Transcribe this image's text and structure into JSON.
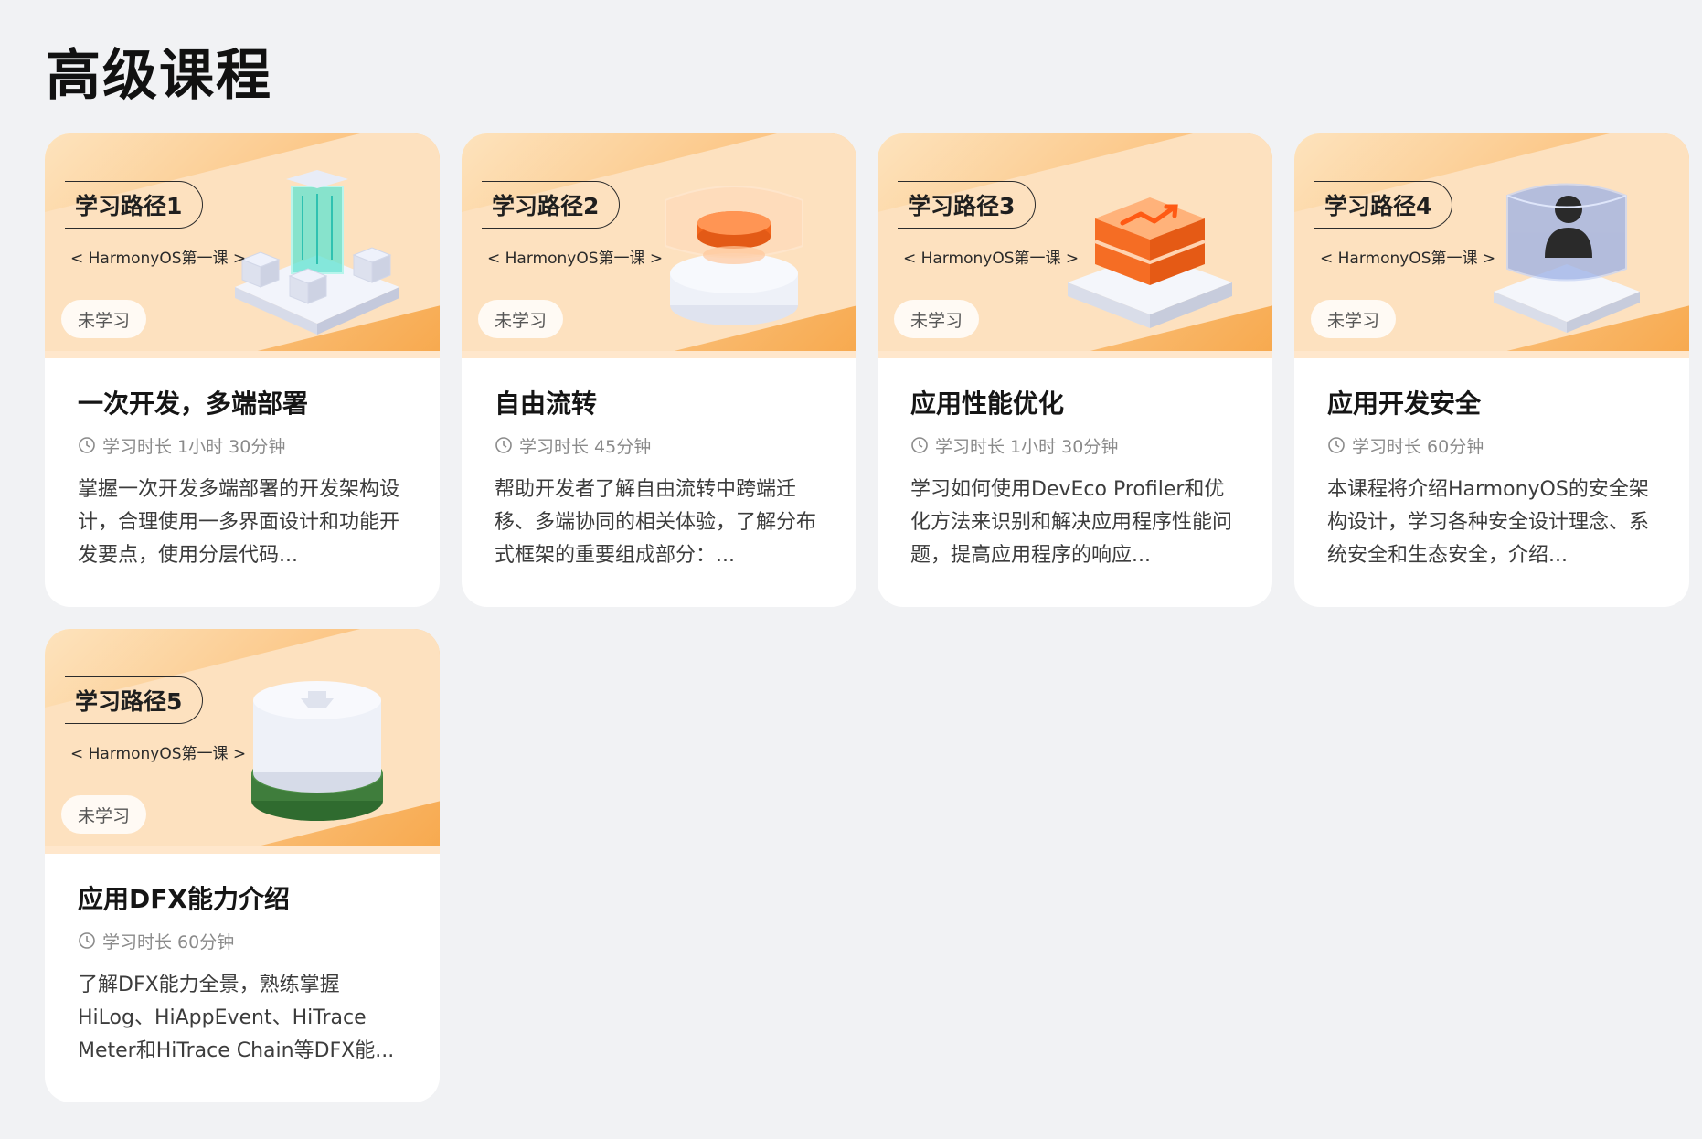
{
  "page": {
    "title": "高级课程"
  },
  "colors": {
    "background": "#f1f2f4",
    "banner_gradient_light": "#fde3bd",
    "banner_gradient_dark": "#f7a94e",
    "card": "#ffffff"
  },
  "cards": [
    {
      "path_label": "学习路径1",
      "subtitle": "< HarmonyOS第一课 >",
      "status": "未学习",
      "title": "一次开发，多端部署",
      "duration": "学习时长 1小时 30分钟",
      "description": "掌握一次开发多端部署的开发架构设计，合理使用一多界面设计和功能开发要点，使用分层代码...",
      "icon": "multi-device-icon"
    },
    {
      "path_label": "学习路径2",
      "subtitle": "< HarmonyOS第一课 >",
      "status": "未学习",
      "title": "自由流转",
      "duration": "学习时长 45分钟",
      "description": "帮助开发者了解自由流转中跨端迁移、多端协同的相关体验，了解分布式框架的重要组成部分：...",
      "icon": "flow-transfer-icon"
    },
    {
      "path_label": "学习路径3",
      "subtitle": "< HarmonyOS第一课 >",
      "status": "未学习",
      "title": "应用性能优化",
      "duration": "学习时长 1小时 30分钟",
      "description": "学习如何使用DevEco Profiler和优化方法来识别和解决应用程序性能问题，提高应用程序的响应...",
      "icon": "performance-icon"
    },
    {
      "path_label": "学习路径4",
      "subtitle": "< HarmonyOS第一课 >",
      "status": "未学习",
      "title": "应用开发安全",
      "duration": "学习时长 60分钟",
      "description": "本课程将介绍HarmonyOS的安全架构设计，学习各种安全设计理念、系统安全和生态安全，介绍...",
      "icon": "security-user-icon"
    },
    {
      "path_label": "学习路径5",
      "subtitle": "< HarmonyOS第一课 >",
      "status": "未学习",
      "title": "应用DFX能力介绍",
      "duration": "学习时长 60分钟",
      "description": "了解DFX能力全景，熟练掌握HiLog、HiAppEvent、HiTrace Meter和HiTrace Chain等DFX能...",
      "icon": "dfx-cylinder-icon"
    }
  ]
}
